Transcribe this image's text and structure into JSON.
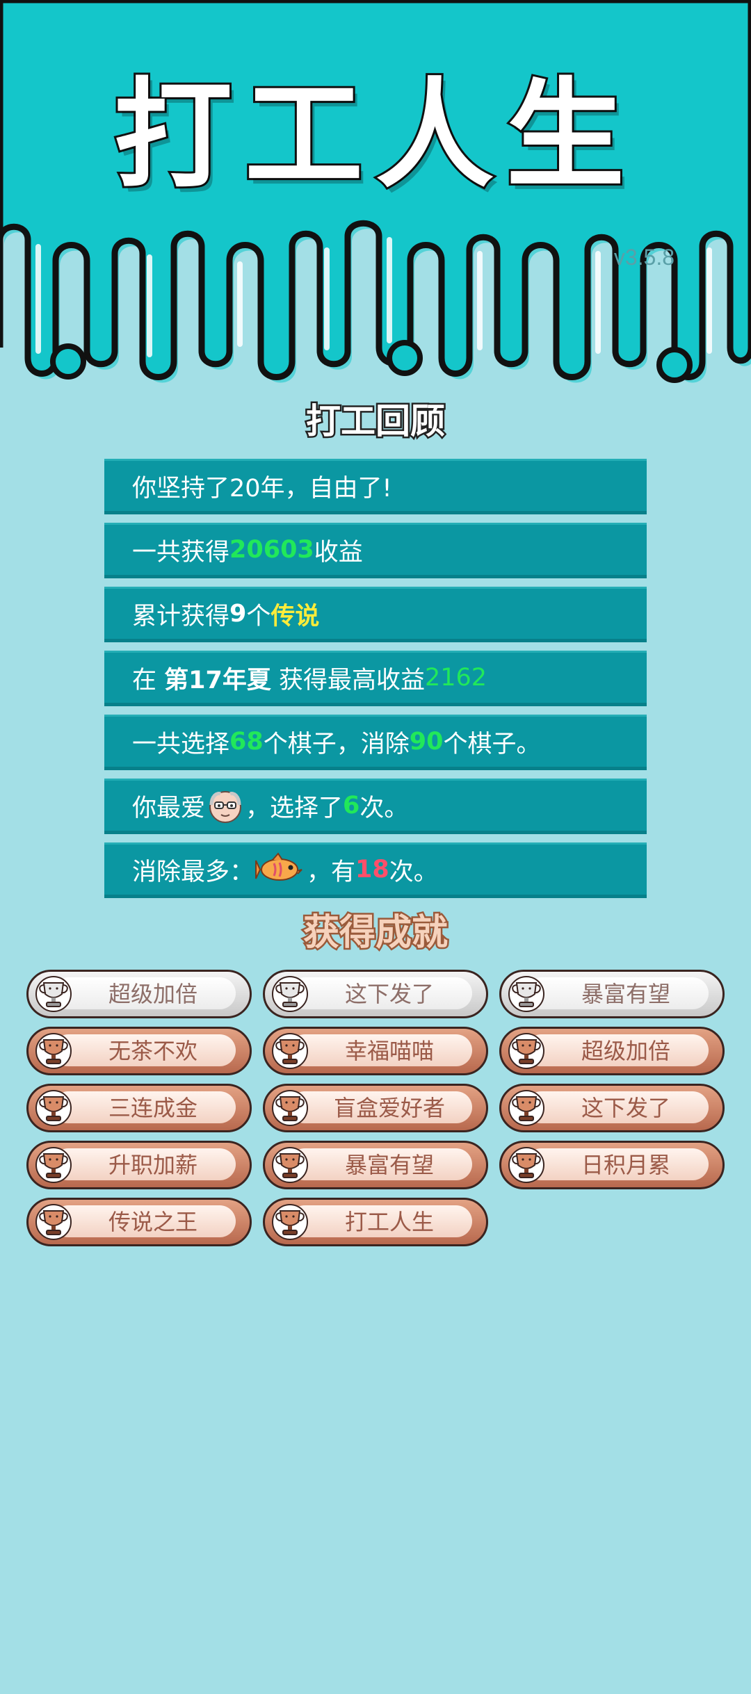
{
  "header": {
    "title": "打工人生",
    "version": "v3.5.8"
  },
  "review": {
    "title": "打工回顾",
    "row1": {
      "text": "你坚持了20年，自由了!"
    },
    "row2": {
      "pre": "一共获得",
      "value": "20603",
      "post": "收益"
    },
    "row3": {
      "pre": "累计获得",
      "count": "9",
      "mid": "个",
      "highlight": "传说"
    },
    "row4": {
      "pre": "在 ",
      "season": "第17年夏",
      "mid": " 获得最高收益",
      "value": "2162"
    },
    "row5": {
      "pre": "一共选择",
      "selected": "68",
      "mid": "个棋子，消除",
      "removed": "90",
      "post": "个棋子。"
    },
    "row6": {
      "pre": "你最爱",
      "mid": "，选择了",
      "count": "6",
      "post": "次。",
      "icon": "old-man-face-icon"
    },
    "row7": {
      "pre": "消除最多：",
      "mid": "，有",
      "count": "18",
      "post": "次。",
      "icon": "fish-icon"
    }
  },
  "achievements": {
    "title": "获得成就",
    "items": [
      {
        "label": "超级加倍",
        "tier": "silver"
      },
      {
        "label": "这下发了",
        "tier": "silver"
      },
      {
        "label": "暴富有望",
        "tier": "silver"
      },
      {
        "label": "无茶不欢",
        "tier": "bronze"
      },
      {
        "label": "幸福喵喵",
        "tier": "bronze"
      },
      {
        "label": "超级加倍",
        "tier": "bronze"
      },
      {
        "label": "三连成金",
        "tier": "bronze"
      },
      {
        "label": "盲盒爱好者",
        "tier": "bronze"
      },
      {
        "label": "这下发了",
        "tier": "bronze"
      },
      {
        "label": "升职加薪",
        "tier": "bronze"
      },
      {
        "label": "暴富有望",
        "tier": "bronze"
      },
      {
        "label": "日积月累",
        "tier": "bronze"
      },
      {
        "label": "传说之王",
        "tier": "bronze"
      },
      {
        "label": "打工人生",
        "tier": "bronze"
      }
    ]
  },
  "colors": {
    "header_bg": "#14c6ca",
    "page_bg": "#a3dfe6",
    "row_bg": "#0b97a2",
    "green": "#21e85a",
    "yellow": "#ffec3a",
    "red": "#ff4f6a",
    "bronze": "#c67c5e",
    "silver": "#d4d4d4"
  }
}
